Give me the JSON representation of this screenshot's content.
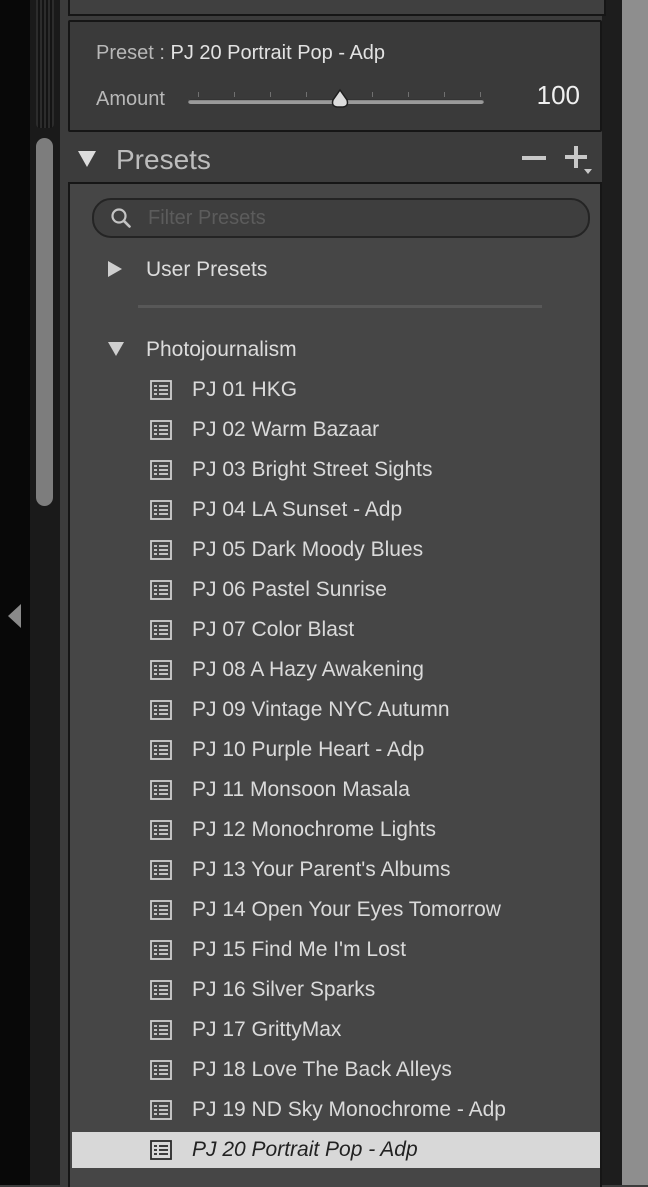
{
  "preset_box": {
    "preset_label": "Preset : ",
    "preset_name": "PJ 20 Portrait Pop - Adp",
    "amount_label": "Amount",
    "amount_value": "100",
    "slider_fraction": 0.5
  },
  "presets_panel": {
    "title": "Presets",
    "remove_icon": "minus-icon",
    "add_icon": "plus-icon",
    "filter_placeholder": "Filter Presets",
    "groups": [
      {
        "label": "User Presets",
        "expanded": false
      },
      {
        "label": "Photojournalism",
        "expanded": true
      }
    ],
    "items": [
      "PJ 01 HKG",
      "PJ 02 Warm Bazaar",
      "PJ 03 Bright Street Sights",
      "PJ 04 LA Sunset - Adp",
      "PJ 05 Dark Moody Blues",
      "PJ 06 Pastel Sunrise",
      "PJ 07 Color Blast",
      "PJ 08 A Hazy Awakening",
      "PJ 09 Vintage NYC Autumn",
      "PJ 10 Purple Heart - Adp",
      "PJ 11 Monsoon Masala",
      "PJ 12 Monochrome Lights",
      "PJ 13 Your Parent's Albums",
      "PJ 14 Open Your Eyes Tomorrow",
      "PJ 15 Find Me I'm Lost",
      "PJ 16 Silver Sparks",
      "PJ 17 GrittyMax",
      "PJ 18 Love The Back Alleys",
      "PJ 19 ND Sky Monochrome - Adp",
      "PJ 20 Portrait Pop - Adp"
    ],
    "selected_item": "PJ 20 Portrait Pop - Adp"
  }
}
